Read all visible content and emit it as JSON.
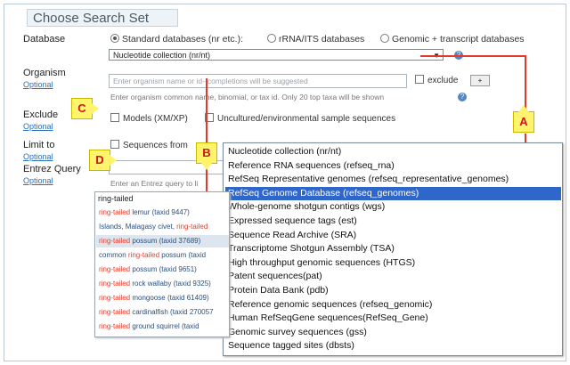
{
  "title": "Choose Search Set",
  "database": {
    "label": "Database",
    "radios": [
      {
        "label": "Standard databases (nr etc.):",
        "checked": true
      },
      {
        "label": "rRNA/ITS databases",
        "checked": false
      },
      {
        "label": "Genomic + transcript databases",
        "checked": false
      }
    ],
    "select_value": "Nucleotide collection (nr/nt)"
  },
  "organism": {
    "label": "Organism",
    "optional": "Optional",
    "placeholder": "Enter organism name or id--completions will be suggested",
    "exclude_label": "exclude",
    "add_label": "+",
    "hint": "Enter organism common name, binomial, or tax id. Only 20 top taxa will be shown"
  },
  "exclude": {
    "label": "Exclude",
    "optional": "Optional",
    "option1": "Models (XM/XP)",
    "option2": "Uncultured/environmental sample sequences"
  },
  "limit_to": {
    "label": "Limit to",
    "optional": "Optional",
    "option": "Sequences from"
  },
  "entrez": {
    "label": "Entrez Query",
    "optional": "Optional",
    "hint": "Enter an Entrez query to li"
  },
  "callouts": {
    "a": "A",
    "b": "B",
    "c": "C",
    "d": "D"
  },
  "dropdown": {
    "selected_index": 3,
    "items": [
      "Nucleotide collection (nr/nt)",
      "Reference RNA sequences (refseq_rna)",
      "RefSeq Representative genomes (refseq_representative_genomes)",
      "RefSeq Genome Database (refseq_genomes)",
      "Whole-genome shotgun contigs (wgs)",
      "Expressed sequence tags (est)",
      "Sequence Read Archive (SRA)",
      "Transcriptome Shotgun Assembly (TSA)",
      "High throughput genomic sequences (HTGS)",
      "Patent sequences(pat)",
      "Protein Data Bank (pdb)",
      "Reference genomic sequences (refseq_genomic)",
      "Human RefSeqGene sequences(RefSeq_Gene)",
      "Genomic survey sequences (gss)",
      "Sequence tagged sites (dbsts)"
    ]
  },
  "autocomplete": {
    "query": "ring-tailed",
    "hovered_index": 2,
    "items": [
      {
        "pre": "",
        "hl": "ring-tailed",
        "post": " lemur (taxid 9447)"
      },
      {
        "pre": "Islands, Malagasy civet, ",
        "hl": "ring-tailed",
        "post": ""
      },
      {
        "pre": "",
        "hl": "ring-tailed",
        "post": " possum (taxid 37689)"
      },
      {
        "pre": "common ",
        "hl": "ring-tailed",
        "post": " possum (taxid"
      },
      {
        "pre": "",
        "hl": "ring-tailed",
        "post": " possum (taxid 9651)"
      },
      {
        "pre": "",
        "hl": "ring-tailed",
        "post": " rock wallaby (taxid 9325)"
      },
      {
        "pre": "",
        "hl": "ring-tailed",
        "post": " mongoose (taxid 61409)"
      },
      {
        "pre": "",
        "hl": "ring-tailed",
        "post": " cardinalfish (taxid 270057"
      },
      {
        "pre": "",
        "hl": "ring-tailed",
        "post": " ground squirrel (taxid"
      }
    ]
  }
}
